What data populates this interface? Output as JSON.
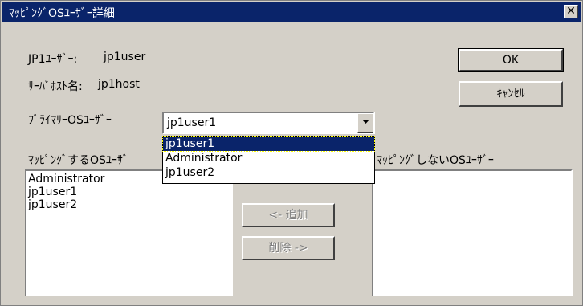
{
  "title": "ﾏｯﾋﾟﾝｸﾞOSﾕｰｻﾞｰ詳細",
  "close_glyph": "✕",
  "jp1_user": {
    "label": "JP1ﾕｰｻﾞｰ:",
    "value": "jp1user"
  },
  "server_host": {
    "label": "ｻｰﾊﾞﾎｽﾄ名:",
    "value": "jp1host"
  },
  "primary_os_user": {
    "label": "ﾌﾟﾗｲﾏﾘｰOSﾕｰｻﾞｰ",
    "value": "jp1user1",
    "options": [
      "jp1user1",
      "Administrator",
      "jp1user2"
    ],
    "selected_option": "jp1user1"
  },
  "buttons": {
    "ok": "OK",
    "cancel": "ｷｬﾝｾﾙ",
    "add": "<- 追加",
    "remove": "削除 ->"
  },
  "mapped_list": {
    "label": "ﾏｯﾋﾟﾝｸﾞするOSﾕｰｻﾞ",
    "items": [
      "Administrator",
      "jp1user1",
      "jp1user2"
    ]
  },
  "unmapped_list": {
    "label": "ﾏｯﾋﾟﾝｸﾞしないOSﾕｰｻﾞｰ",
    "items": []
  },
  "colors": {
    "titlebar": "#0a246a",
    "dialog_bg": "#d4d0c8",
    "selection": "#0a246a"
  }
}
